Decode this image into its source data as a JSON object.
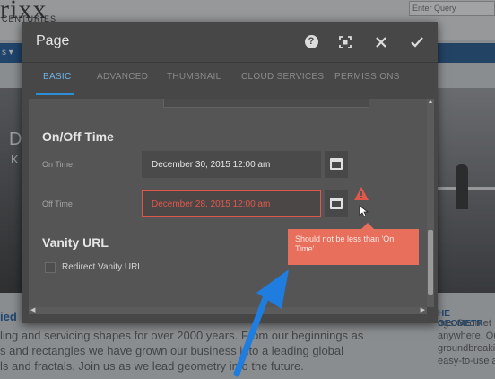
{
  "background_page": {
    "logo_text": "rixx",
    "logo_subtext": "CENTURIES",
    "search_placeholder": "Enter Query",
    "nav_left": "s ▾",
    "hero_left_big": "D",
    "hero_left_small": "K",
    "heading_left": "ied",
    "heading_right": "HE GEOMETR",
    "body_lines": [
      "ling and servicing shapes for over 2000 years. From our beginnings as",
      "s and rectangles we have grown our business into a leading global",
      "ls and fractals. Join us as we lead geometry into the future."
    ],
    "right_lines": [
      "ngs Geomet",
      "anywhere. Our m",
      "groundbreaking a",
      "easy-to-use as ou"
    ]
  },
  "dialog": {
    "title": "Page",
    "header_buttons": {
      "help": "?",
      "fullscreen": "⛶",
      "close": "✕",
      "done": "✓"
    },
    "tabs": [
      {
        "label": "BASIC",
        "active": true
      },
      {
        "label": "ADVANCED",
        "active": false
      },
      {
        "label": "THUMBNAIL",
        "active": false
      },
      {
        "label": "CLOUD SERVICES",
        "active": false
      },
      {
        "label": "PERMISSIONS",
        "active": false
      }
    ],
    "sections": {
      "onoff": {
        "title": "On/Off Time",
        "on_time_label": "On Time",
        "on_time_value": "December 30, 2015 12:00 am",
        "off_time_label": "Off Time",
        "off_time_value": "December 28, 2015 12:00 am"
      },
      "vanity": {
        "title": "Vanity URL",
        "redirect_label": "Redirect Vanity URL",
        "redirect_checked": false
      }
    },
    "error_tooltip": "Should not be less than 'On Time'"
  },
  "colors": {
    "accent": "#2b8fd6",
    "error": "#e1584b",
    "tooltip": "#e86f5b",
    "annotation_arrow": "#1f7de0"
  }
}
